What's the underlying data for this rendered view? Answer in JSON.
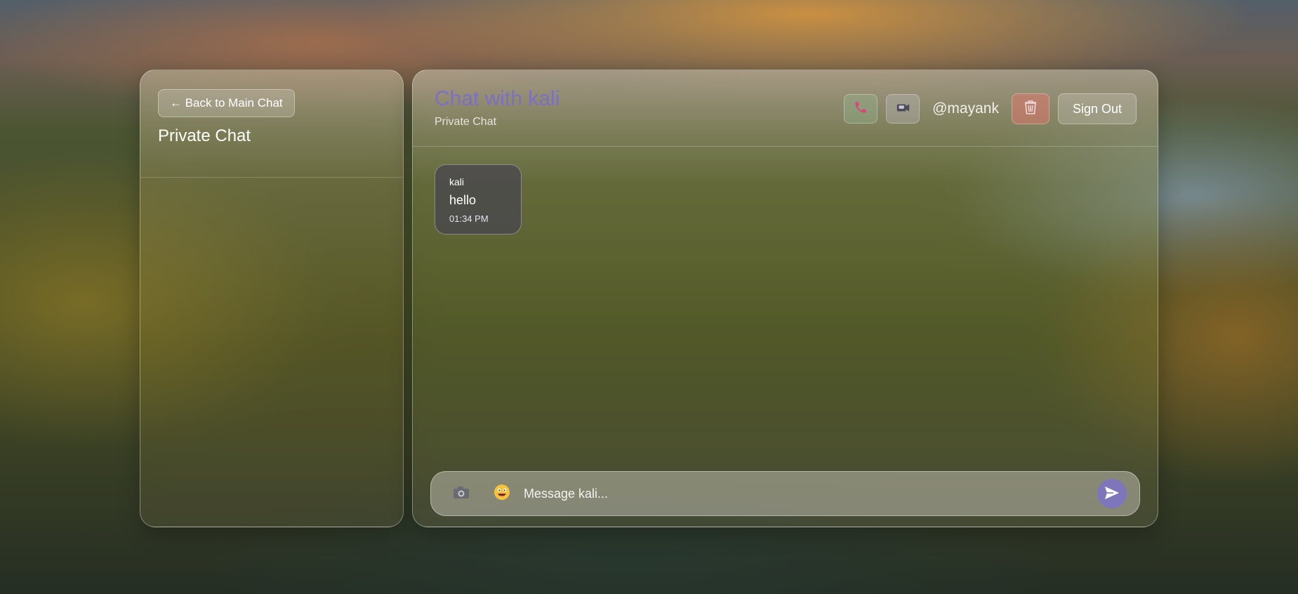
{
  "sidebar": {
    "back_label": "← Back to Main Chat",
    "title": "Private Chat"
  },
  "header": {
    "title": "Chat with kali",
    "subtitle": "Private Chat",
    "username": "@mayank",
    "signout_label": "Sign Out",
    "icons": {
      "call": "phone-icon",
      "video": "video-camera-icon",
      "delete": "trash-icon"
    }
  },
  "messages": [
    {
      "sender": "kali",
      "text": "hello",
      "time": "01:34 PM"
    }
  ],
  "composer": {
    "placeholder": "Message kali...",
    "icons": {
      "camera": "camera-icon",
      "emoji": "emoji-icon",
      "send": "send-icon"
    }
  },
  "colors": {
    "accent": "#7b6fc9",
    "call_icon": "#e0407a",
    "delete_bg": "#dc786e"
  }
}
